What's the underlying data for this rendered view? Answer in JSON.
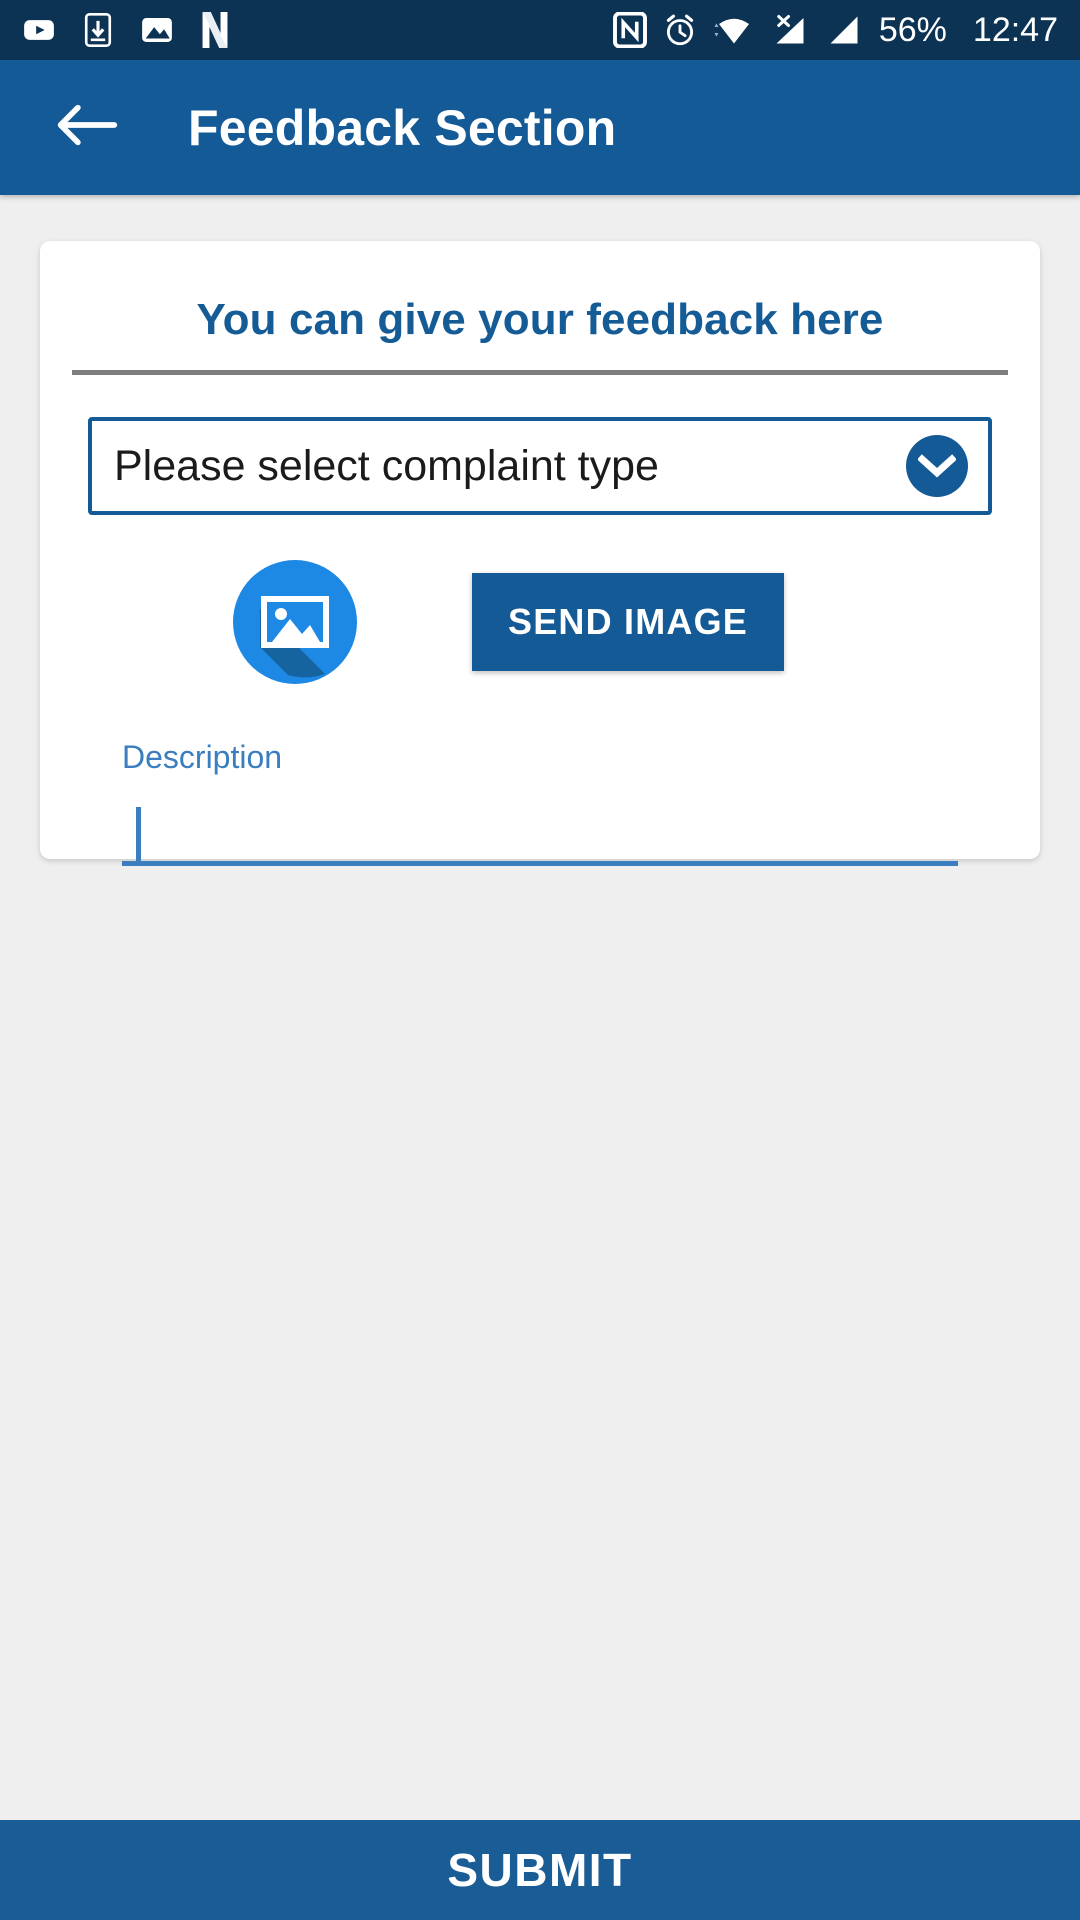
{
  "status_bar": {
    "background": "#0d3354",
    "left_icons": [
      {
        "name": "youtube-icon"
      },
      {
        "name": "phone-download-icon"
      },
      {
        "name": "gallery-image-icon"
      },
      {
        "name": "n-app-icon"
      }
    ],
    "right_icons": [
      {
        "name": "nfc-icon"
      },
      {
        "name": "alarm-clock-icon"
      },
      {
        "name": "wifi-icon"
      },
      {
        "name": "no-sim-signal-icon"
      },
      {
        "name": "cell-signal-icon"
      }
    ],
    "battery": "56%",
    "time": "12:47"
  },
  "app_bar": {
    "background": "#145a96",
    "back_icon": "arrow-left-icon",
    "title": "Feedback Section"
  },
  "card": {
    "title": "You can give your feedback here",
    "title_color": "#155b96",
    "divider_color": "#7d7d7d",
    "select": {
      "value": "Please select complaint type",
      "chevron_icon": "chevron-down-icon",
      "border_color": "#145a96"
    },
    "image_picker": {
      "icon": "picture-placeholder-icon",
      "button_label": "SEND IMAGE",
      "button_color": "#145a96"
    },
    "description": {
      "label": "Description",
      "value": "",
      "placeholder": "",
      "accent_color": "#3b7ec0"
    }
  },
  "footer": {
    "submit_label": "SUBMIT",
    "background": "#1a5c96"
  }
}
